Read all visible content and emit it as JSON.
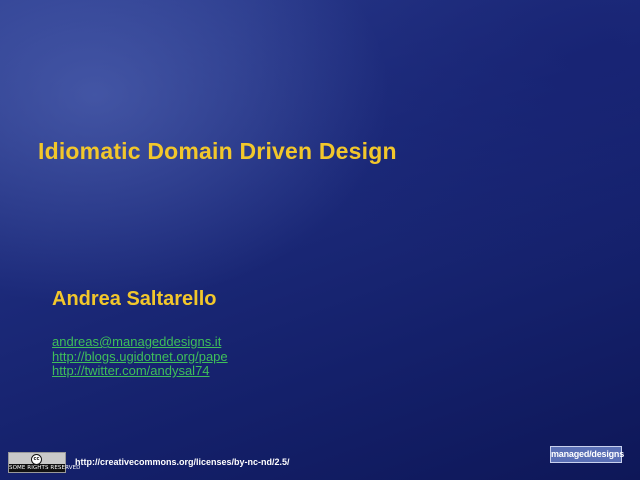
{
  "slide": {
    "title": "Idiomatic Domain Driven Design",
    "author": "Andrea Saltarello",
    "links": [
      "andreas@manageddesigns.it",
      "http://blogs.ugidotnet.org/pape",
      "http://twitter.com/andysal74"
    ]
  },
  "footer": {
    "cc_badge": {
      "icon_text": "cc",
      "label": "SOME RIGHTS RESERVED"
    },
    "license_url": "http://creativecommons.org/licenses/by-nc-nd/2.5/",
    "logo_text": "managed/designs"
  },
  "colors": {
    "title": "#f2c72b",
    "link": "#3fbf5a",
    "background": "#1c2a7a"
  }
}
